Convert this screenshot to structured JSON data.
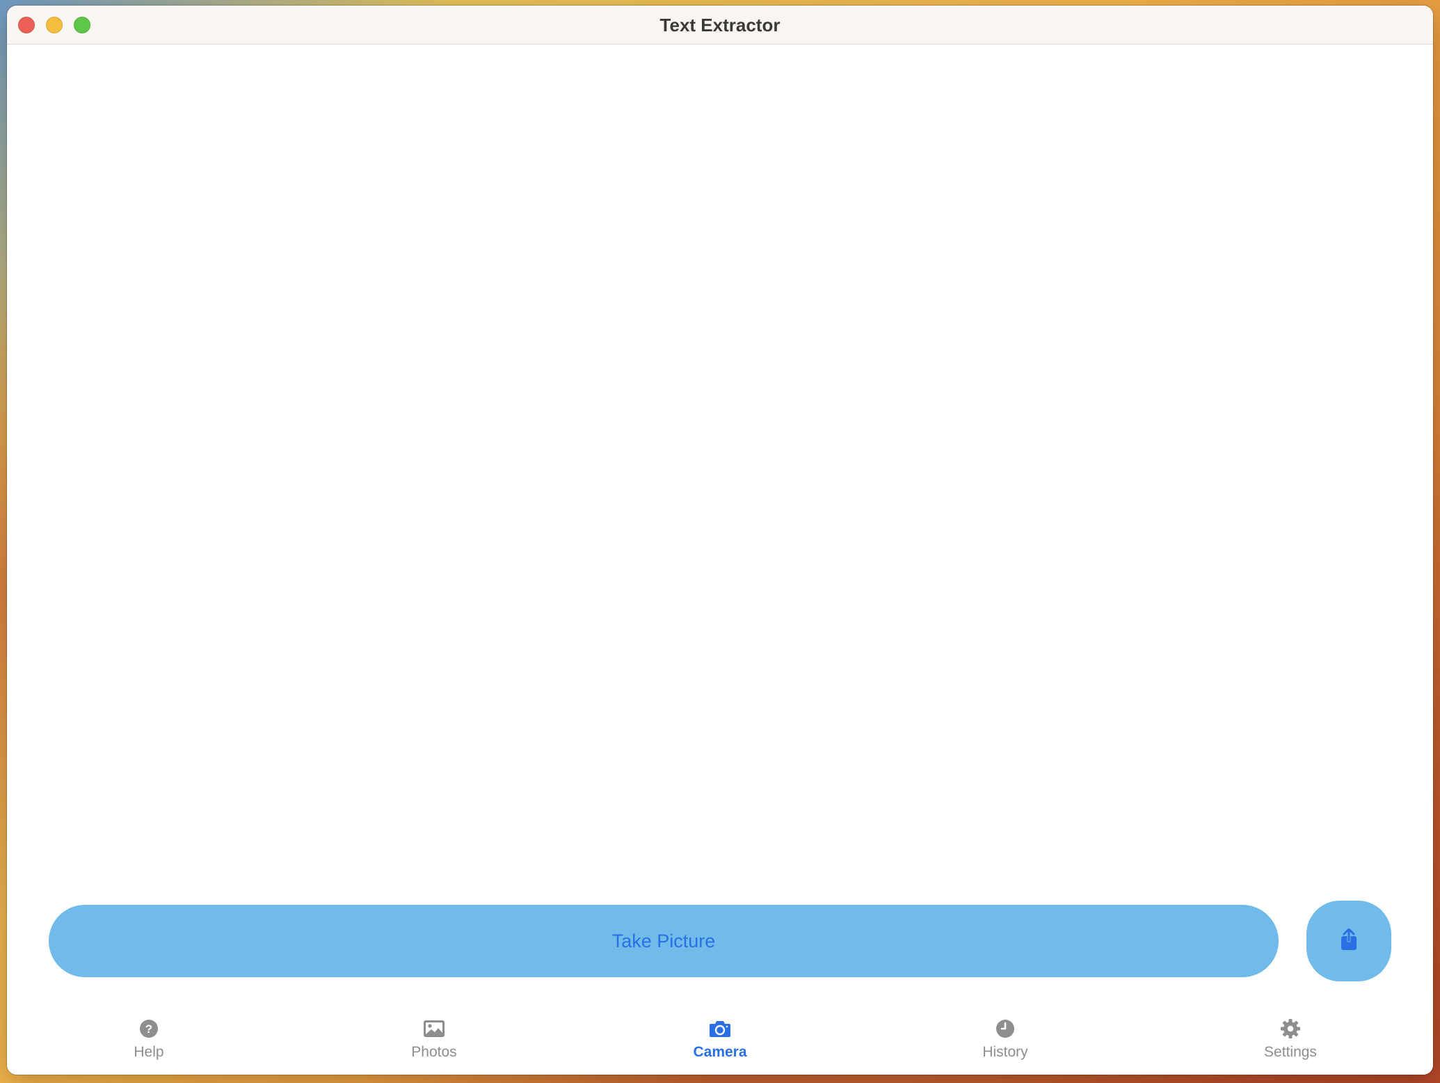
{
  "window": {
    "title": "Text Extractor"
  },
  "actions": {
    "take_picture_label": "Take Picture"
  },
  "tabs": [
    {
      "label": "Help",
      "icon": "question-circle-icon",
      "active": false
    },
    {
      "label": "Photos",
      "icon": "photo-icon",
      "active": false
    },
    {
      "label": "Camera",
      "icon": "camera-icon",
      "active": true
    },
    {
      "label": "History",
      "icon": "clock-icon",
      "active": false
    },
    {
      "label": "Settings",
      "icon": "gear-icon",
      "active": false
    }
  ],
  "colors": {
    "accent": "#2a6fe3",
    "button_fill": "#71bbea",
    "inactive_tab": "#8e8e8e"
  }
}
